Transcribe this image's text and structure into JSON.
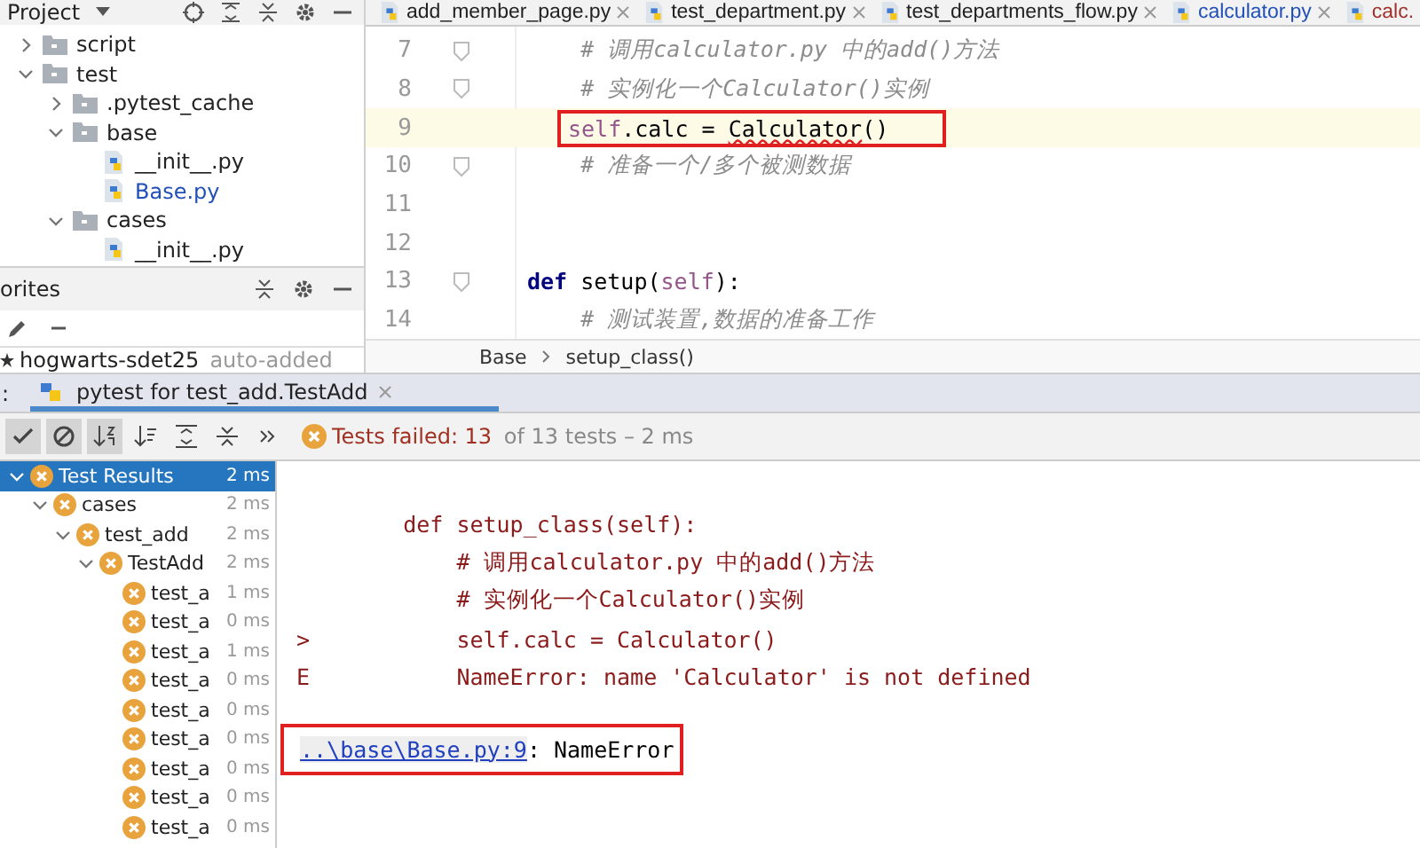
{
  "project_panel": {
    "title": "Project",
    "tree": [
      {
        "label": "script",
        "kind": "folder",
        "expanded": false,
        "modified": false
      },
      {
        "label": "test",
        "kind": "folder",
        "expanded": true,
        "modified": false,
        "children": [
          {
            "label": ".pytest_cache",
            "kind": "folder",
            "expanded": false,
            "modified": false
          },
          {
            "label": "base",
            "kind": "folder",
            "expanded": true,
            "modified": false,
            "children": [
              {
                "label": "__init__.py",
                "kind": "file",
                "modified": false
              },
              {
                "label": "Base.py",
                "kind": "file",
                "modified": true
              }
            ]
          },
          {
            "label": "cases",
            "kind": "folder",
            "expanded": true,
            "modified": false,
            "children": [
              {
                "label": "__init__.py",
                "kind": "file",
                "modified": false
              }
            ]
          }
        ]
      }
    ]
  },
  "favorites_panel": {
    "title": "orites",
    "items": [
      {
        "label": "hogwarts-sdet25",
        "note": "auto-added"
      }
    ]
  },
  "editor": {
    "tabs": [
      {
        "label": "add_member_page.py",
        "modified": false,
        "error": false
      },
      {
        "label": "test_department.py",
        "modified": false,
        "error": false
      },
      {
        "label": "test_departments_flow.py",
        "modified": false,
        "error": false
      },
      {
        "label": "calculator.py",
        "modified": true,
        "error": false
      },
      {
        "label": "calc.",
        "modified": false,
        "error": true
      }
    ],
    "lines": [
      {
        "number": "7",
        "fold": true,
        "highlighted": false,
        "segments": [
          {
            "kind": "comment",
            "text": "    # 调用calculator.py 中的add()方法"
          }
        ]
      },
      {
        "number": "8",
        "fold": true,
        "highlighted": false,
        "segments": [
          {
            "kind": "comment",
            "text": "    # 实例化一个Calculator()实例"
          }
        ]
      },
      {
        "number": "9",
        "fold": false,
        "highlighted": true,
        "boxed": true,
        "segments": [
          {
            "kind": "self",
            "text": "self"
          },
          {
            "kind": "plain",
            "text": ".calc = "
          },
          {
            "kind": "error",
            "text": "Calculator"
          },
          {
            "kind": "plain",
            "text": "()"
          }
        ]
      },
      {
        "number": "10",
        "fold": true,
        "highlighted": false,
        "segments": [
          {
            "kind": "comment",
            "text": "    # 准备一个/多个被测数据"
          }
        ]
      },
      {
        "number": "11",
        "fold": false,
        "highlighted": false
      },
      {
        "number": "12",
        "fold": false,
        "highlighted": false
      },
      {
        "number": "13",
        "fold": true,
        "highlighted": false,
        "segments": [
          {
            "kind": "keyword",
            "text": "def "
          },
          {
            "kind": "plain",
            "text": "setup("
          },
          {
            "kind": "self",
            "text": "self"
          },
          {
            "kind": "plain",
            "text": "):"
          }
        ]
      },
      {
        "number": "14",
        "fold": false,
        "highlighted": false,
        "segments": [
          {
            "kind": "comment",
            "text": "    # 测试装置,数据的准备工作"
          }
        ]
      }
    ],
    "breadcrumb": [
      "Base",
      "setup_class()"
    ]
  },
  "run_panel": {
    "label": ":",
    "tab": "pytest for test_add.TestAdd",
    "toolbar": [
      {
        "kind": "check",
        "selected": true
      },
      {
        "kind": "ban",
        "selected": true
      },
      {
        "kind": "sort-alpha",
        "selected": true
      },
      {
        "kind": "sort-duration",
        "selected": false
      },
      {
        "kind": "expand",
        "selected": false
      },
      {
        "kind": "collapse",
        "selected": false
      },
      {
        "kind": "more",
        "selected": false
      }
    ],
    "status_failed": "Tests failed: 13",
    "status_rest": " of 13 tests – 2 ms",
    "results": [
      {
        "label": "Test Results",
        "time": "2 ms",
        "selected": true,
        "children": [
          {
            "label": "cases",
            "time": "2 ms",
            "selected": false,
            "children": [
              {
                "label": "test_add",
                "time": "2 ms",
                "selected": false,
                "children": [
                  {
                    "label": "TestAdd",
                    "time": "2 ms",
                    "selected": false,
                    "children": [
                      {
                        "label": "test_a",
                        "time": "1 ms",
                        "selected": false
                      },
                      {
                        "label": "test_a",
                        "time": "0 ms",
                        "selected": false
                      },
                      {
                        "label": "test_a",
                        "time": "1 ms",
                        "selected": false
                      },
                      {
                        "label": "test_a",
                        "time": "0 ms",
                        "selected": false
                      },
                      {
                        "label": "test_a",
                        "time": "0 ms",
                        "selected": false
                      },
                      {
                        "label": "test_a",
                        "time": "0 ms",
                        "selected": false
                      },
                      {
                        "label": "test_a",
                        "time": "0 ms",
                        "selected": false
                      },
                      {
                        "label": "test_a",
                        "time": "0 ms",
                        "selected": false
                      },
                      {
                        "label": "test_a",
                        "time": "0 ms",
                        "selected": false
                      }
                    ]
                  }
                ]
              }
            ]
          }
        ]
      }
    ],
    "output": [
      {
        "text": "    def setup_class(self):"
      },
      {
        "text": "        # 调用calculator.py 中的add()方法"
      },
      {
        "text": "        # 实例化一个Calculator()实例"
      },
      {
        "prefix": ">",
        "text": "        self.calc = Calculator()"
      },
      {
        "prefix": "E",
        "text": "        NameError: name 'Calculator' is not defined"
      }
    ],
    "error_link": "..\\base\\Base.py:9",
    "error_type": ": NameError"
  }
}
